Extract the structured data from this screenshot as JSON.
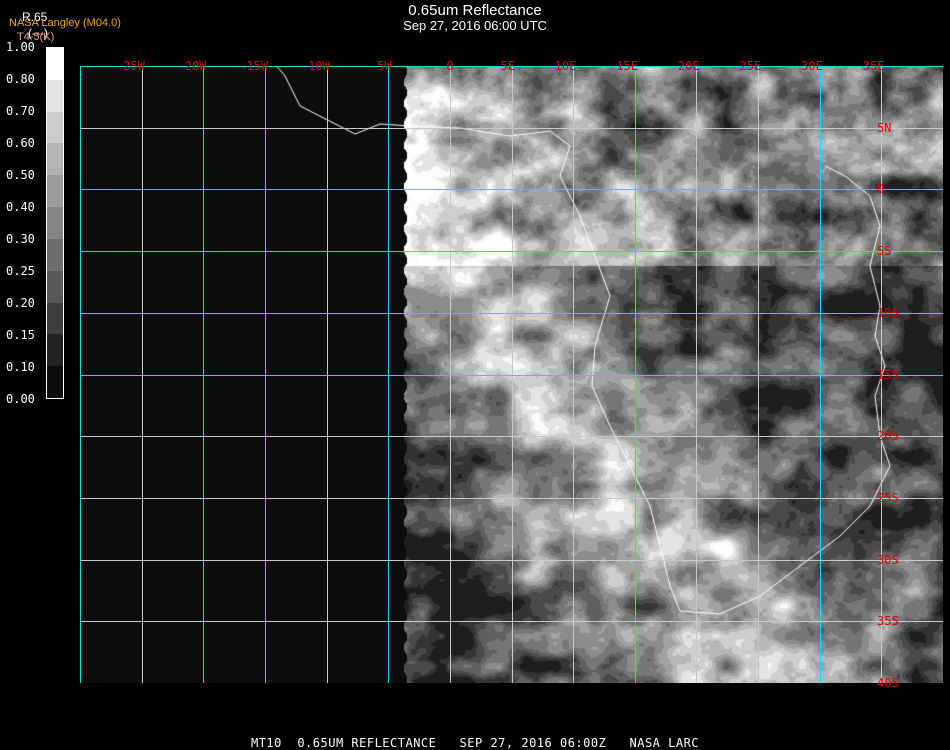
{
  "header": {
    "title": "0.65um Reflectance",
    "datetime": "Sep 27, 2016 06:00 UTC",
    "product": "R.65",
    "unit": "(---)",
    "source": "NASA Langley (M04.0)",
    "sub": "T4-5(K)"
  },
  "colorbar": {
    "labels": [
      "1.00",
      "0.80",
      "0.70",
      "0.60",
      "0.50",
      "0.40",
      "0.30",
      "0.25",
      "0.20",
      "0.15",
      "0.10",
      "0.00"
    ],
    "colors": [
      "#ffffff",
      "#e3e3e3",
      "#cccccc",
      "#b3b3b3",
      "#9c9c9c",
      "#858585",
      "#6e6e6e",
      "#575757",
      "#3d3d3d",
      "#232323",
      "#0d0d0d"
    ]
  },
  "map": {
    "lon_labels": [
      "25W",
      "20W",
      "15W",
      "10W",
      "5W",
      "0",
      "5E",
      "10E",
      "15E",
      "20E",
      "25E",
      "30E",
      "35E"
    ],
    "lat_labels": [
      "5N",
      "0",
      "5S",
      "10S",
      "15S",
      "20S",
      "25S",
      "30S",
      "35S",
      "40S"
    ],
    "grid_color": "#00e5ee",
    "label_color": "#e00000"
  },
  "footer": "MT10  0.65UM REFLECTANCE   SEP 27, 2016 06:00Z   NASA LARC"
}
